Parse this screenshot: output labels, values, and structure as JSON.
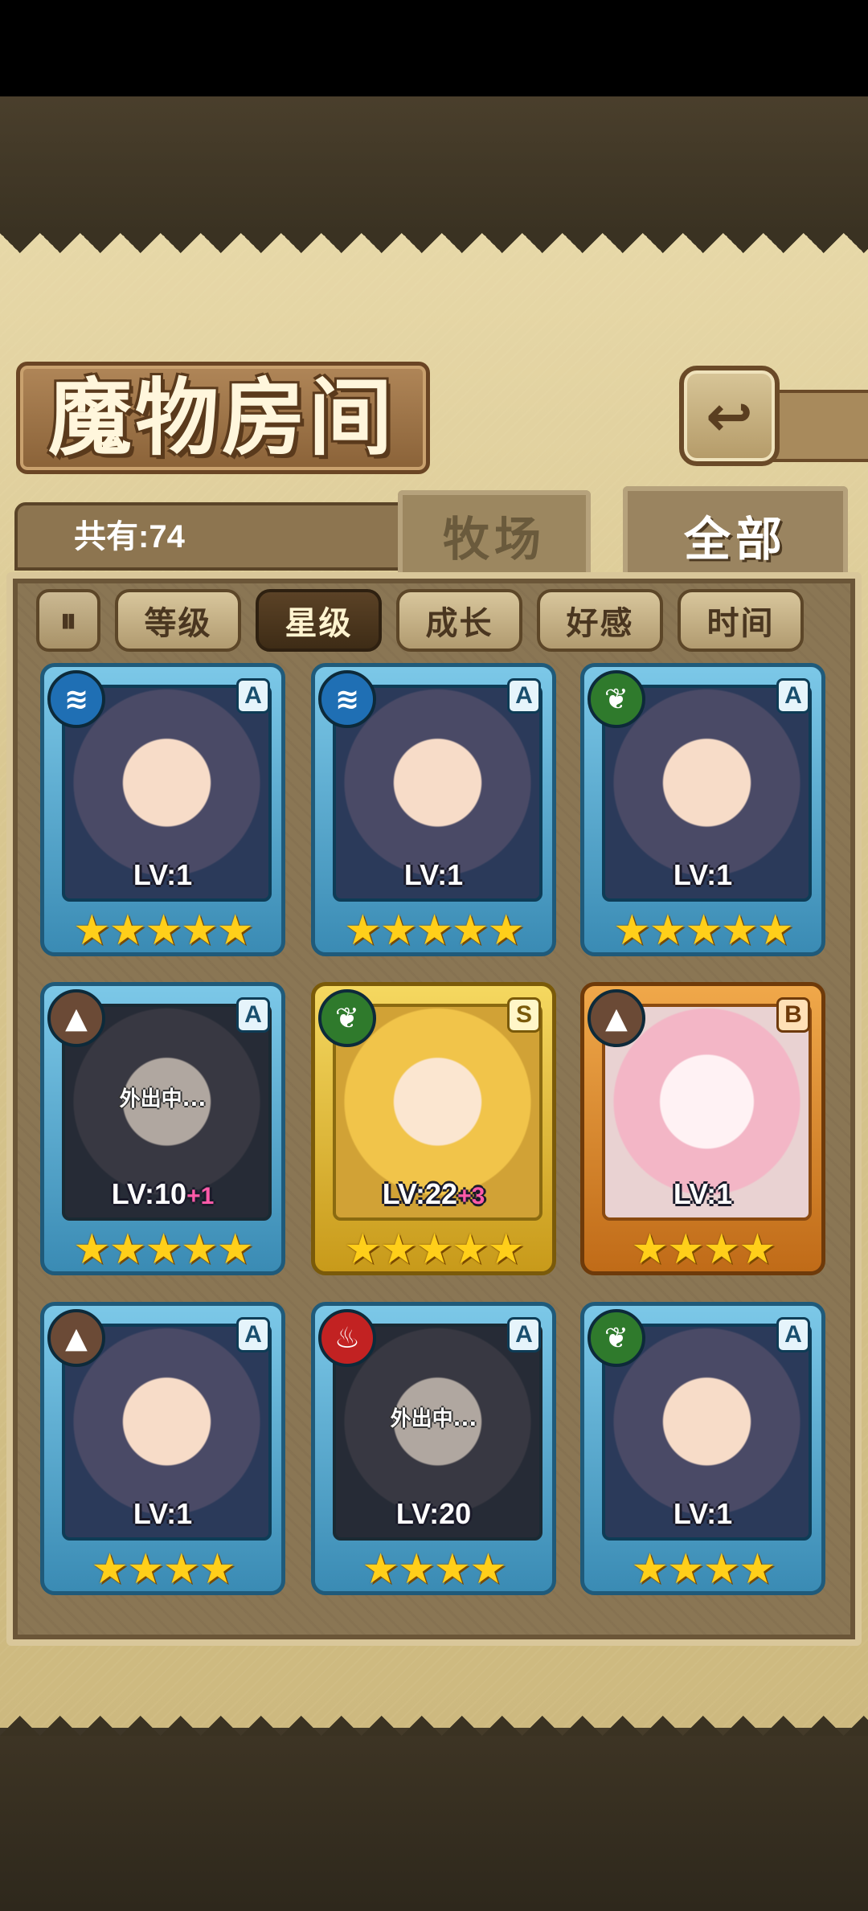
{
  "header": {
    "title": "魔物房间",
    "back_icon": "return-arrow-icon"
  },
  "summary": {
    "count_label": "共有:74"
  },
  "tabs": [
    {
      "label": "牧场",
      "active": false
    },
    {
      "label": "全部",
      "active": true
    }
  ],
  "filters": {
    "toggle_icon": "sort-toggle-icon",
    "items": [
      {
        "label": "等级",
        "active": false
      },
      {
        "label": "星级",
        "active": true
      },
      {
        "label": "成长",
        "active": false
      },
      {
        "label": "好感",
        "active": false
      },
      {
        "label": "时间",
        "active": false
      }
    ]
  },
  "monsters": [
    {
      "element": "water",
      "element_glyph": "≋",
      "rank": "A",
      "level": "LV:1",
      "bonus": "",
      "stars": "★★★★★",
      "away": ""
    },
    {
      "element": "water",
      "element_glyph": "≋",
      "rank": "A",
      "level": "LV:1",
      "bonus": "",
      "stars": "★★★★★",
      "away": ""
    },
    {
      "element": "nature",
      "element_glyph": "❦",
      "rank": "A",
      "level": "LV:1",
      "bonus": "",
      "stars": "★★★★★",
      "away": ""
    },
    {
      "element": "earth",
      "element_glyph": "▲",
      "rank": "A",
      "level": "LV:10",
      "bonus": "+1",
      "stars": "★★★★★",
      "away": "外出中..."
    },
    {
      "element": "nature",
      "element_glyph": "❦",
      "rank": "S",
      "level": "LV:22",
      "bonus": "+3",
      "stars": "★★★★★",
      "away": ""
    },
    {
      "element": "earth",
      "element_glyph": "▲",
      "rank": "B",
      "level": "LV:1",
      "bonus": "",
      "stars": "★★★★",
      "away": ""
    },
    {
      "element": "earth",
      "element_glyph": "▲",
      "rank": "A",
      "level": "LV:1",
      "bonus": "",
      "stars": "★★★★",
      "away": ""
    },
    {
      "element": "fire",
      "element_glyph": "♨",
      "rank": "A",
      "level": "LV:20",
      "bonus": "",
      "stars": "★★★★",
      "away": "外出中..."
    },
    {
      "element": "nature",
      "element_glyph": "❦",
      "rank": "A",
      "level": "LV:1",
      "bonus": "",
      "stars": "★★★★",
      "away": ""
    }
  ]
}
